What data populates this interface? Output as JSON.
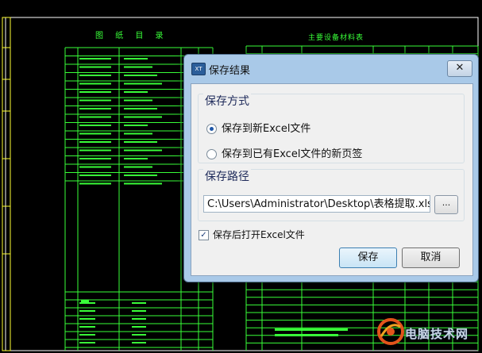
{
  "background": {
    "left_title": "图 纸 目 录",
    "right_title": "主要设备材料表"
  },
  "dialog": {
    "title": "保存结果",
    "app_icon_text": "XT",
    "close_glyph": "✕",
    "save_mode": {
      "legend": "保存方式",
      "options": [
        {
          "label": "保存到新Excel文件",
          "selected": true
        },
        {
          "label": "保存到已有Excel文件的新页签",
          "selected": false
        }
      ]
    },
    "save_path": {
      "legend": "保存路径",
      "value": "C:\\Users\\Administrator\\Desktop\\表格提取.xls",
      "browse_label": "..."
    },
    "open_after_save": {
      "label": "保存后打开Excel文件",
      "checked": true,
      "check_glyph": "✓"
    },
    "save_button": "保存",
    "cancel_button": "取消"
  },
  "colors": {
    "cad_line": "#39ff39",
    "cad_frame": "#ffffff",
    "cad_yellow": "#ffff33",
    "dialog_frame": "#a9c9e8"
  },
  "watermark": {
    "text": "电脑技术网"
  }
}
